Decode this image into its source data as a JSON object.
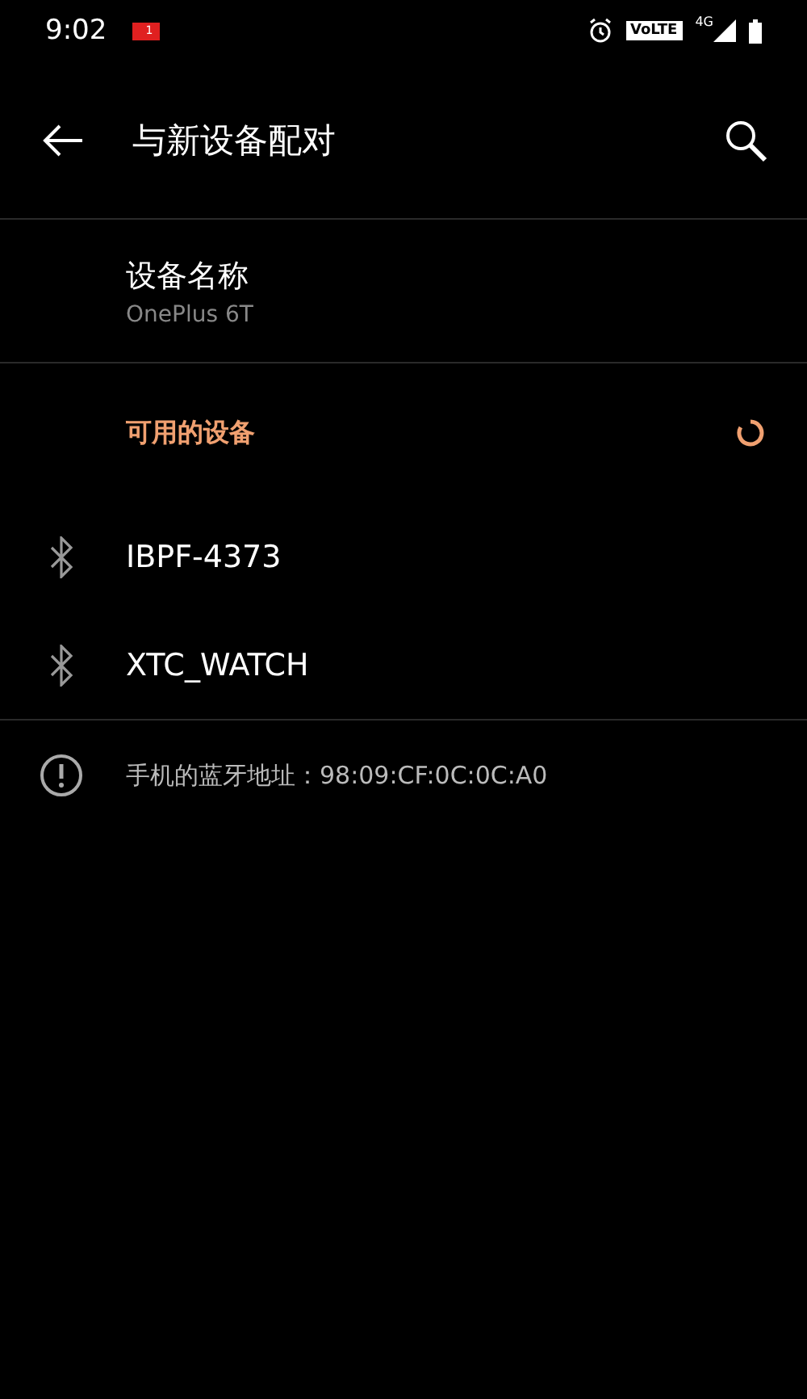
{
  "status_bar": {
    "time": "9:02",
    "notification_count": "1",
    "volte": "VoLTE",
    "network": "4G"
  },
  "toolbar": {
    "title": "与新设备配对"
  },
  "device_name": {
    "label": "设备名称",
    "value": "OnePlus 6T"
  },
  "section": {
    "title": "可用的设备",
    "scanning": true
  },
  "devices": [
    {
      "name": "IBPF-4373"
    },
    {
      "name": "XTC_WATCH"
    }
  ],
  "info": {
    "text": "手机的蓝牙地址：98:09:CF:0C:0C:A0"
  }
}
